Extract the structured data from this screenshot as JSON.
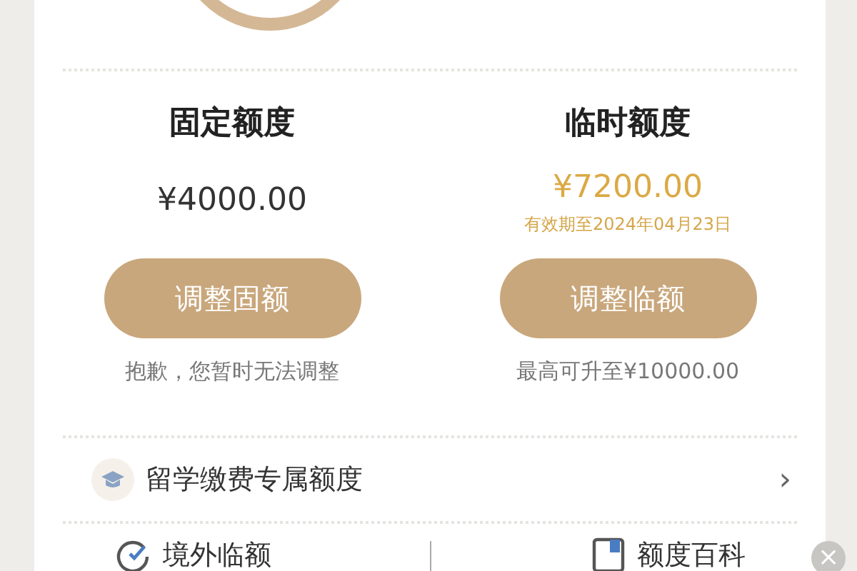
{
  "quotas": [
    {
      "title": "固定额度",
      "amount": "¥4000.00",
      "button": "调整固额",
      "note": "抱歉，您暂时无法调整",
      "highlight": false
    },
    {
      "title": "临时额度",
      "amount": "¥7200.00",
      "validity": "有效期至2024年04月23日",
      "button": "调整临额",
      "note": "最高可升至¥10000.00",
      "highlight": true
    }
  ],
  "link_row": {
    "label": "留学缴费专属额度",
    "chevron": "›"
  },
  "shortcuts": [
    {
      "kind": "check",
      "label": "境外临额"
    },
    {
      "kind": "book",
      "label": "额度百科"
    }
  ],
  "close": "×"
}
